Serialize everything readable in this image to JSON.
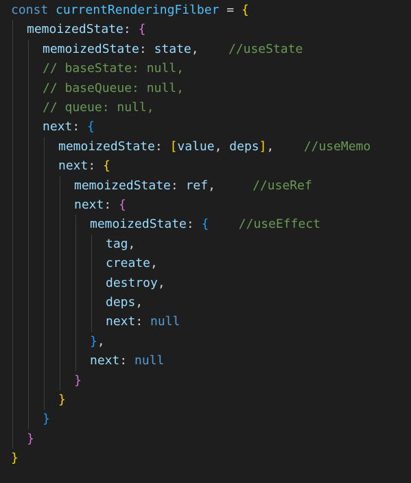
{
  "editor": {
    "theme_colors": {
      "background": "#1e1e1e",
      "keyword": "#569cd6",
      "variable": "#4fc1ff",
      "property": "#9cdcfe",
      "comment": "#6a9955",
      "bracket_level_1": "#ffd700",
      "bracket_level_2": "#da70d6",
      "bracket_level_3": "#179fff",
      "indent_guide": "#404040"
    },
    "lines": [
      {
        "indent": 0,
        "tokens": [
          {
            "t": "const",
            "c": "kw"
          },
          {
            "t": " ",
            "c": "op"
          },
          {
            "t": "currentRenderingFilber",
            "c": "var"
          },
          {
            "t": " = ",
            "c": "op"
          },
          {
            "t": "{",
            "c": "b1"
          }
        ]
      },
      {
        "indent": 1,
        "tokens": [
          {
            "t": "memoizedState",
            "c": "prop"
          },
          {
            "t": ": ",
            "c": "op"
          },
          {
            "t": "{",
            "c": "b2"
          }
        ]
      },
      {
        "indent": 2,
        "tokens": [
          {
            "t": "memoizedState",
            "c": "prop"
          },
          {
            "t": ": ",
            "c": "op"
          },
          {
            "t": "state",
            "c": "prop"
          },
          {
            "t": ",    ",
            "c": "op"
          },
          {
            "t": "//useState",
            "c": "cmt"
          }
        ]
      },
      {
        "indent": 2,
        "tokens": [
          {
            "t": "// baseState: null,",
            "c": "cmt"
          }
        ]
      },
      {
        "indent": 2,
        "tokens": [
          {
            "t": "// baseQueue: null,",
            "c": "cmt"
          }
        ]
      },
      {
        "indent": 2,
        "tokens": [
          {
            "t": "// queue: null,",
            "c": "cmt"
          }
        ]
      },
      {
        "indent": 2,
        "tokens": [
          {
            "t": "next",
            "c": "prop"
          },
          {
            "t": ": ",
            "c": "op"
          },
          {
            "t": "{",
            "c": "b3"
          }
        ]
      },
      {
        "indent": 3,
        "tokens": [
          {
            "t": "memoizedState",
            "c": "prop"
          },
          {
            "t": ": ",
            "c": "op"
          },
          {
            "t": "[",
            "c": "b1"
          },
          {
            "t": "value",
            "c": "prop"
          },
          {
            "t": ", ",
            "c": "op"
          },
          {
            "t": "deps",
            "c": "prop"
          },
          {
            "t": "]",
            "c": "b1"
          },
          {
            "t": ",    ",
            "c": "op"
          },
          {
            "t": "//useMemo",
            "c": "cmt"
          }
        ]
      },
      {
        "indent": 3,
        "tokens": [
          {
            "t": "next",
            "c": "prop"
          },
          {
            "t": ": ",
            "c": "op"
          },
          {
            "t": "{",
            "c": "b1"
          }
        ]
      },
      {
        "indent": 4,
        "tokens": [
          {
            "t": "memoizedState",
            "c": "prop"
          },
          {
            "t": ": ",
            "c": "op"
          },
          {
            "t": "ref",
            "c": "prop"
          },
          {
            "t": ",     ",
            "c": "op"
          },
          {
            "t": "//useRef",
            "c": "cmt"
          }
        ]
      },
      {
        "indent": 4,
        "tokens": [
          {
            "t": "next",
            "c": "prop"
          },
          {
            "t": ": ",
            "c": "op"
          },
          {
            "t": "{",
            "c": "b2"
          }
        ]
      },
      {
        "indent": 5,
        "tokens": [
          {
            "t": "memoizedState",
            "c": "prop"
          },
          {
            "t": ": ",
            "c": "op"
          },
          {
            "t": "{",
            "c": "b3"
          },
          {
            "t": "    ",
            "c": "op"
          },
          {
            "t": "//useEffect",
            "c": "cmt"
          }
        ]
      },
      {
        "indent": 6,
        "tokens": [
          {
            "t": "tag",
            "c": "prop"
          },
          {
            "t": ",",
            "c": "op"
          }
        ]
      },
      {
        "indent": 6,
        "tokens": [
          {
            "t": "create",
            "c": "prop"
          },
          {
            "t": ",",
            "c": "op"
          }
        ]
      },
      {
        "indent": 6,
        "tokens": [
          {
            "t": "destroy",
            "c": "prop"
          },
          {
            "t": ",",
            "c": "op"
          }
        ]
      },
      {
        "indent": 6,
        "tokens": [
          {
            "t": "deps",
            "c": "prop"
          },
          {
            "t": ",",
            "c": "op"
          }
        ]
      },
      {
        "indent": 6,
        "tokens": [
          {
            "t": "next",
            "c": "prop"
          },
          {
            "t": ": ",
            "c": "op"
          },
          {
            "t": "null",
            "c": "lit"
          }
        ]
      },
      {
        "indent": 5,
        "tokens": [
          {
            "t": "}",
            "c": "b3"
          },
          {
            "t": ",",
            "c": "op"
          }
        ]
      },
      {
        "indent": 5,
        "tokens": [
          {
            "t": "next",
            "c": "prop"
          },
          {
            "t": ": ",
            "c": "op"
          },
          {
            "t": "null",
            "c": "lit"
          }
        ]
      },
      {
        "indent": 4,
        "tokens": [
          {
            "t": "}",
            "c": "b2"
          }
        ]
      },
      {
        "indent": 3,
        "tokens": [
          {
            "t": "}",
            "c": "b1"
          }
        ]
      },
      {
        "indent": 2,
        "tokens": [
          {
            "t": "}",
            "c": "b3"
          }
        ]
      },
      {
        "indent": 1,
        "tokens": [
          {
            "t": "}",
            "c": "b2"
          }
        ]
      },
      {
        "indent": 0,
        "tokens": [
          {
            "t": "}",
            "c": "b1"
          }
        ]
      }
    ]
  }
}
